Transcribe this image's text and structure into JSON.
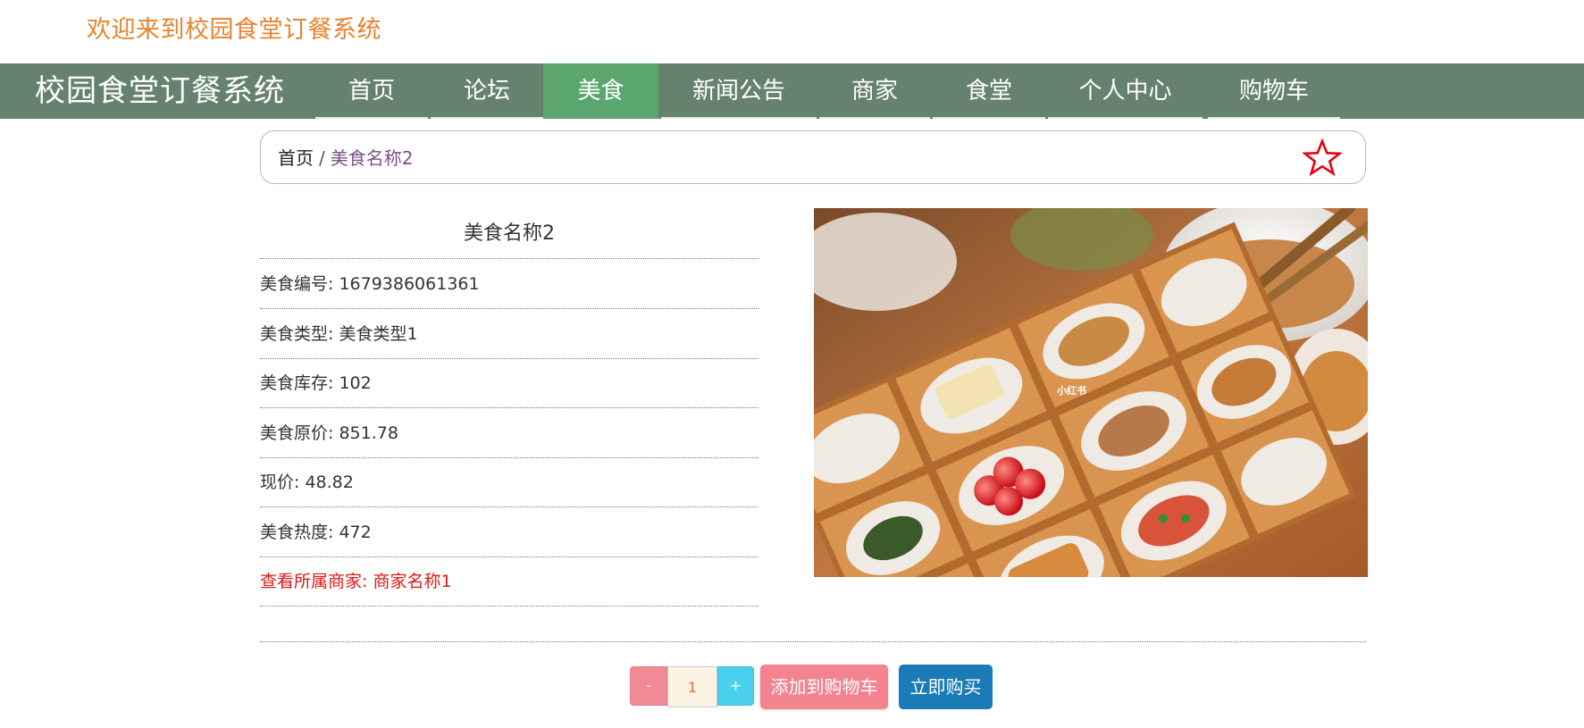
{
  "header": {
    "welcome_text": "欢迎来到校园食堂订餐系统"
  },
  "navbar": {
    "brand": "校园食堂订餐系统",
    "items": [
      {
        "label": "首页"
      },
      {
        "label": "论坛"
      },
      {
        "label": "美食",
        "active": true
      },
      {
        "label": "新闻公告"
      },
      {
        "label": "商家"
      },
      {
        "label": "食堂"
      },
      {
        "label": "个人中心"
      },
      {
        "label": "购物车"
      }
    ],
    "colors": {
      "bar": "#66826f",
      "active": "#5aa66e"
    }
  },
  "breadcrumb": {
    "home": "首页",
    "separator": "/",
    "current": "美食名称2",
    "favorite_icon": "star-outline-icon",
    "favorite_color": "#e60012"
  },
  "product": {
    "name": "美食名称2",
    "fields": [
      {
        "label": "美食编号",
        "value": "1679386061361",
        "text": "美食编号: 1679386061361"
      },
      {
        "label": "美食类型",
        "value": "美食类型1",
        "text": "美食类型: 美食类型1"
      },
      {
        "label": "美食库存",
        "value": "102",
        "text": "美食库存: 102"
      },
      {
        "label": "美食原价",
        "value": "851.78",
        "text": "美食原价: 851.78"
      },
      {
        "label": "现价",
        "value": "48.82",
        "text": "现价: 48.82"
      },
      {
        "label": "美食热度",
        "value": "472",
        "text": "美食热度: 472"
      }
    ],
    "merchant_link": "查看所属商家: 商家名称1",
    "photo_watermark": "小红书"
  },
  "purchase": {
    "minus": "-",
    "quantity": "1",
    "plus": "+",
    "add_to_cart": "添加到购物车",
    "buy_now": "立即购买"
  }
}
